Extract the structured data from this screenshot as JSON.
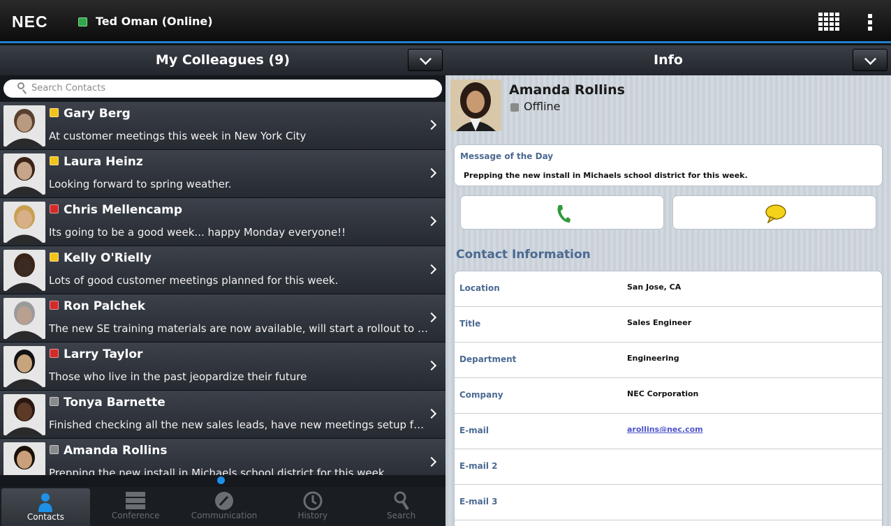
{
  "topbar": {
    "logo": "NEC",
    "user_status": "Ted Oman (Online)",
    "icons": [
      "grid-apps-icon",
      "overflow-menu-icon"
    ]
  },
  "left_pane": {
    "title": "My Colleagues (9)",
    "search_placeholder": "Search Contacts",
    "contacts": [
      {
        "name": "Gary Berg",
        "status": "away",
        "message": "At customer meetings this week in New York City"
      },
      {
        "name": "Laura Heinz",
        "status": "away",
        "message": "Looking forward to spring weather."
      },
      {
        "name": "Chris Mellencamp",
        "status": "busy",
        "message": "Its going to be a good week... happy Monday everyone!!"
      },
      {
        "name": "Kelly O'Rielly",
        "status": "away",
        "message": "Lots of good customer meetings planned for this week."
      },
      {
        "name": "Ron Palchek",
        "status": "busy",
        "message": "The new SE training materials are now available, will start a rollout to dealers next week."
      },
      {
        "name": "Larry Taylor",
        "status": "busy",
        "message": "Those who live in the past jeopardize their future"
      },
      {
        "name": "Tonya Barnette",
        "status": "offline",
        "message": "Finished checking all the new sales leads, have new meetings setup for the rest of the month."
      },
      {
        "name": "Amanda Rollins",
        "status": "offline",
        "message": "Prepping the new install in Michaels school district for this week."
      }
    ]
  },
  "tabs": [
    {
      "label": "Contacts",
      "icon": "person-icon",
      "active": true
    },
    {
      "label": "Conference",
      "icon": "conference-icon",
      "active": false
    },
    {
      "label": "Communication",
      "icon": "phone-dial-icon",
      "active": false
    },
    {
      "label": "History",
      "icon": "clock-icon",
      "active": false
    },
    {
      "label": "Search",
      "icon": "search-icon",
      "active": false
    }
  ],
  "right_pane": {
    "title": "Info",
    "contact_name": "Amanda Rollins",
    "contact_status": "Offline",
    "motd_heading": "Message of the Day",
    "motd_text": "Prepping the new install in Michaels school district for this week.",
    "actions": [
      "phone-icon",
      "chat-bubble-icon"
    ],
    "contact_info_title": "Contact Information",
    "fields": [
      {
        "label": "Location",
        "value": "San Jose, CA"
      },
      {
        "label": "Title",
        "value": "Sales Engineer"
      },
      {
        "label": "Department",
        "value": "Engineering"
      },
      {
        "label": "Company",
        "value": "NEC Corporation"
      },
      {
        "label": "E-mail",
        "value": "arollins@nec.com"
      },
      {
        "label": "E-mail 2",
        "value": ""
      },
      {
        "label": "E-mail 3",
        "value": ""
      }
    ]
  },
  "colors": {
    "accent": "#1f7fd0",
    "online": "#2fa84a",
    "away": "#f2c31b",
    "busy": "#d32a2a",
    "offline": "#8a8a8a",
    "label_blue": "#4b6a92"
  }
}
